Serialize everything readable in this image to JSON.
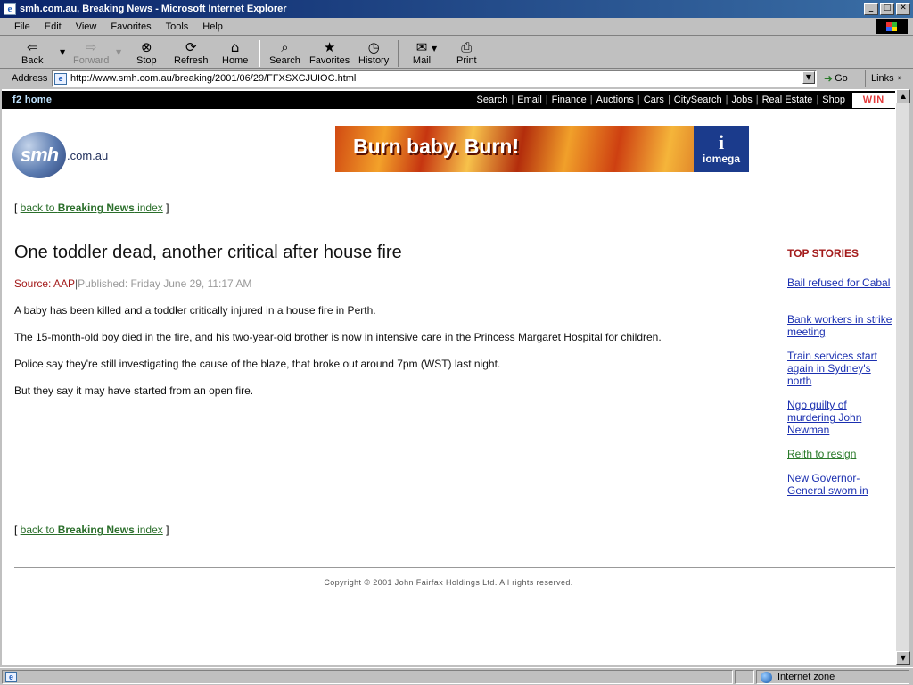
{
  "window": {
    "title": "smh.com.au, Breaking News - Microsoft Internet Explorer",
    "app_icon": "ie-page-icon",
    "controls": [
      "minimize",
      "maximize",
      "close"
    ]
  },
  "menu": {
    "items": [
      "File",
      "Edit",
      "View",
      "Favorites",
      "Tools",
      "Help"
    ]
  },
  "toolbar": {
    "back": "Back",
    "forward": "Forward",
    "stop": "Stop",
    "refresh": "Refresh",
    "home": "Home",
    "search": "Search",
    "favorites": "Favorites",
    "history": "History",
    "mail": "Mail",
    "print": "Print"
  },
  "address": {
    "label": "Address",
    "url": "http://www.smh.com.au/breaking/2001/06/29/FFXSXCJUIOC.html",
    "go": "Go",
    "links": "Links"
  },
  "site": {
    "f2home": "f2 home",
    "nav": [
      "Search",
      "Email",
      "Finance",
      "Auctions",
      "Cars",
      "CitySearch",
      "Jobs",
      "Real Estate",
      "Shop"
    ],
    "win": "WIN",
    "logo_text": "smh",
    "logo_domain": ".com.au",
    "banner_text": "Burn baby. Burn!",
    "banner_brand": "iomega",
    "banner_brand_mark": "i"
  },
  "backlink": {
    "prefix": "back to ",
    "bold": "Breaking News",
    "suffix": " index"
  },
  "article": {
    "headline": "One toddler dead, another critical after house fire",
    "source_label": "Source: ",
    "source": "AAP",
    "published": "Published: Friday June 29, 11:17 AM",
    "paragraphs": [
      "A baby has been killed and a toddler critically injured in a house fire in Perth.",
      "The 15-month-old boy died in the fire, and his two-year-old brother is now in intensive care in the Princess Margaret Hospital for children.",
      "Police say they're still investigating the cause of the blaze, that broke out around 7pm (WST) last night.",
      "But they say it may have started from an open fire."
    ]
  },
  "sidebar": {
    "heading": "TOP STORIES",
    "stories": [
      "Bail refused for Cabal",
      "Bank workers in strike meeting",
      "Train services start again in Sydney's north",
      "Ngo guilty of murdering John Newman",
      "Reith to resign",
      "New Governor-General sworn in"
    ]
  },
  "footer": {
    "copyright": "Copyright © 2001 John Fairfax Holdings Ltd. All rights reserved."
  },
  "status": {
    "zone": "Internet zone"
  }
}
